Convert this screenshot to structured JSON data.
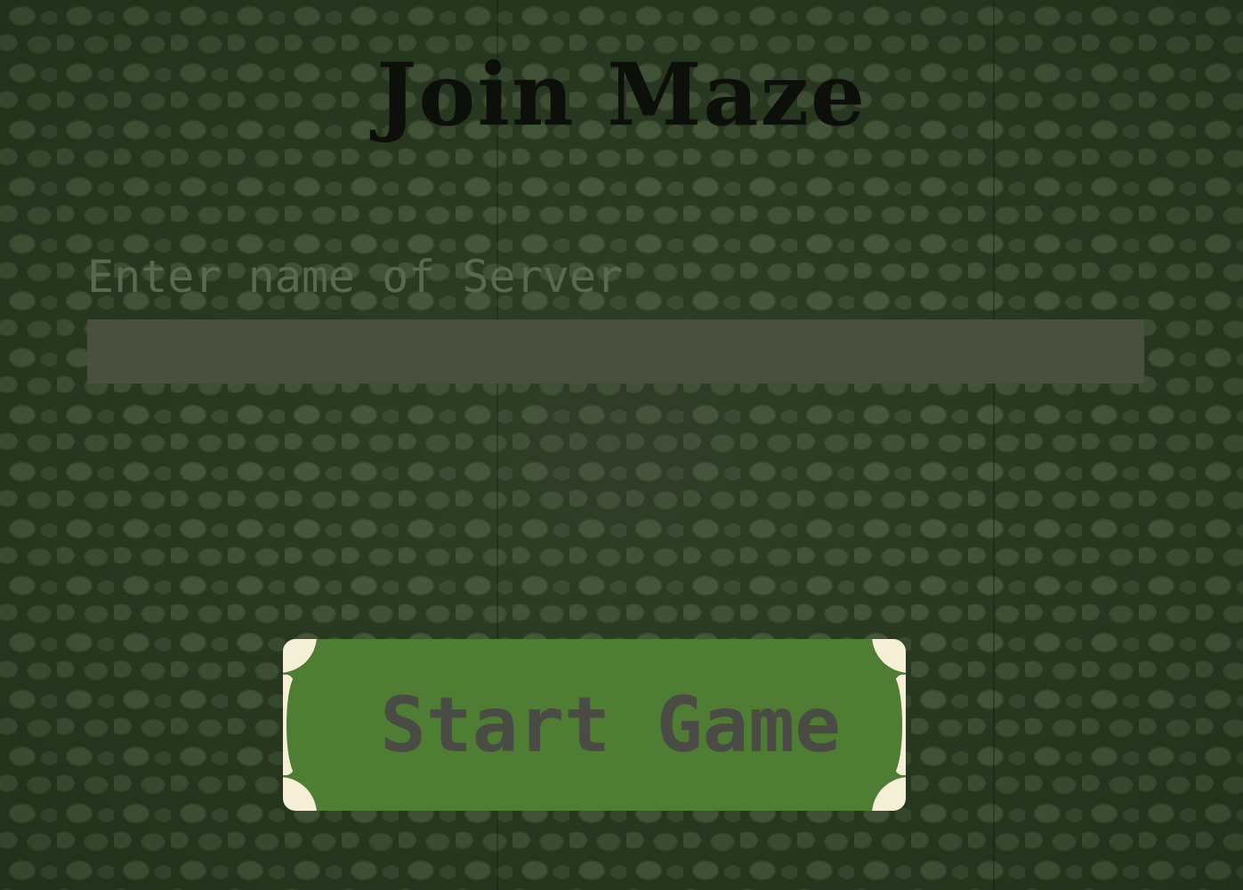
{
  "screen": {
    "title": "Join Maze"
  },
  "server_form": {
    "label": "Enter name of Server",
    "input_value": "",
    "input_placeholder": ""
  },
  "start_button": {
    "label": "Start Game"
  },
  "colors": {
    "background": "#2a3a22",
    "title": "#0c0f0a",
    "label": "#5a6850",
    "input_background": "#4a4f3e",
    "button_background": "#4e7d33",
    "button_text": "#4b4b45",
    "button_corners": "#f6efd8"
  }
}
